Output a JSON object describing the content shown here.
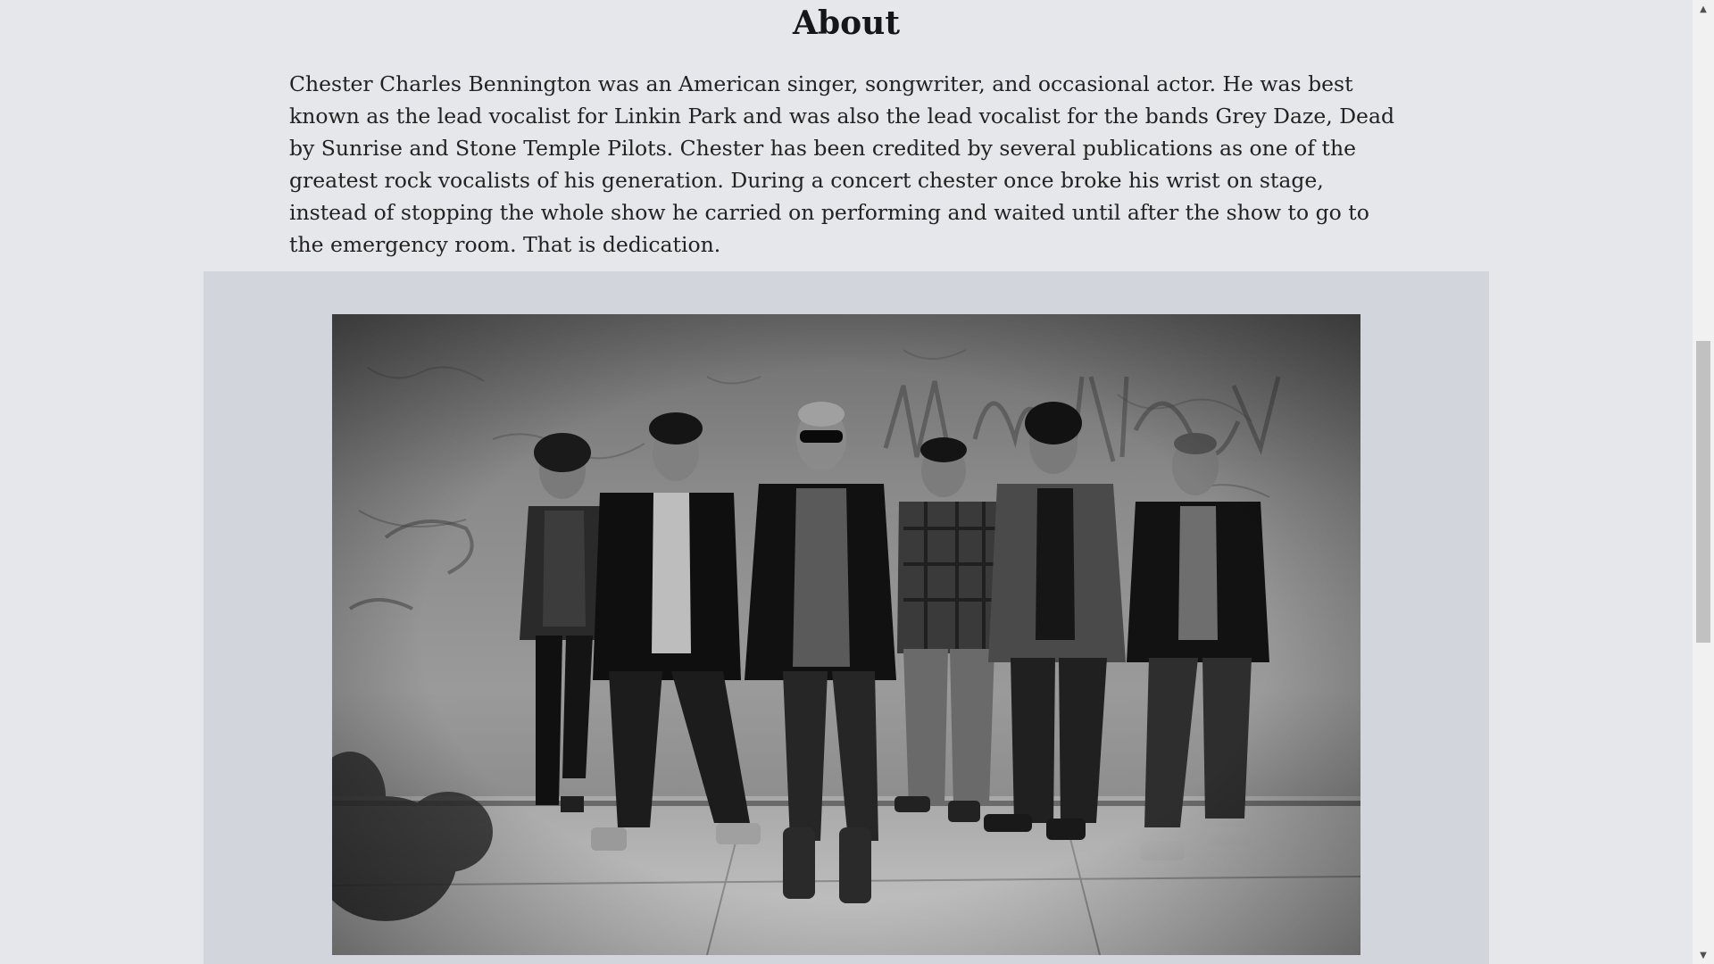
{
  "about": {
    "title": "About",
    "paragraph": "Chester Charles Bennington was an American singer, songwriter, and occasional actor. He was best known as the lead vocalist for Linkin Park and was also the lead vocalist for the bands Grey Daze, Dead by Sunrise and Stone Temple Pilots. Chester has been credited by several publications as one of the greatest rock vocalists of his generation. During a concert chester once broke his wrist on stage, instead of stopping the whole show he carried on performing and waited until after the show to go to the emergency room. That is dedication."
  },
  "photo": {
    "style": "black-and-white group photo of six band members standing against a graffiti-marked concrete wall on a sidewalk"
  },
  "scrollbar": {
    "up_icon": "arrow-up-icon",
    "down_icon": "arrow-down-icon",
    "up_glyph": "▲",
    "down_glyph": "▼"
  },
  "colors": {
    "page_background": "#e6e7ea",
    "panel_background": "#d3d5dd",
    "text": "#222222"
  }
}
